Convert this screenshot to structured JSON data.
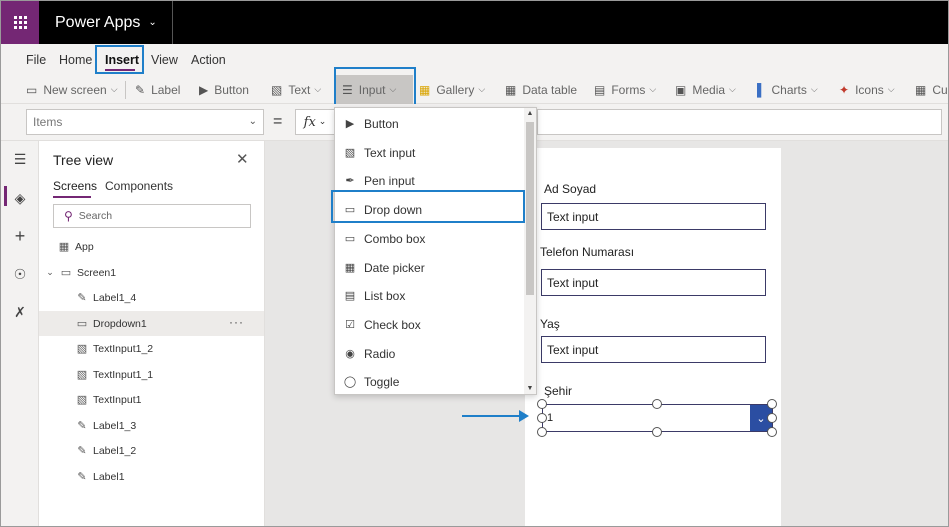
{
  "app": {
    "title": "Power Apps"
  },
  "menubar": {
    "items": [
      "File",
      "Home",
      "Insert",
      "View",
      "Action"
    ],
    "active": "Insert"
  },
  "ribbon": {
    "new_screen": "New screen",
    "label": "Label",
    "button": "Button",
    "text": "Text",
    "input": "Input",
    "gallery": "Gallery",
    "data_table": "Data table",
    "forms": "Forms",
    "media": "Media",
    "charts": "Charts",
    "icons": "Icons",
    "custom_partial": "Cu"
  },
  "formula": {
    "property": "Items",
    "equals": "=",
    "fx": "fx"
  },
  "tree": {
    "title": "Tree view",
    "tabs": [
      "Screens",
      "Components"
    ],
    "search_placeholder": "Search",
    "app_node": "App",
    "screen_node": "Screen1",
    "children": [
      "Label1_4",
      "Dropdown1",
      "TextInput1_2",
      "TextInput1_1",
      "TextInput1",
      "Label1_3",
      "Label1_2",
      "Label1"
    ],
    "more": "···"
  },
  "input_menu": {
    "items": [
      "Button",
      "Text input",
      "Pen input",
      "Drop down",
      "Combo box",
      "Date picker",
      "List box",
      "Check box",
      "Radio",
      "Toggle"
    ],
    "highlighted": "Drop down"
  },
  "canvas": {
    "label_name": "Ad Soyad",
    "label_phone": "Telefon Numarası",
    "label_age": "Yaş",
    "label_city": "Şehir",
    "input1": "Text input",
    "input2": "Text input",
    "input3": "Text input",
    "dropdown_value": "1"
  },
  "colors": {
    "brand": "#742774",
    "highlight": "#1f7fc9",
    "dropdown_button": "#2b4ea2"
  }
}
